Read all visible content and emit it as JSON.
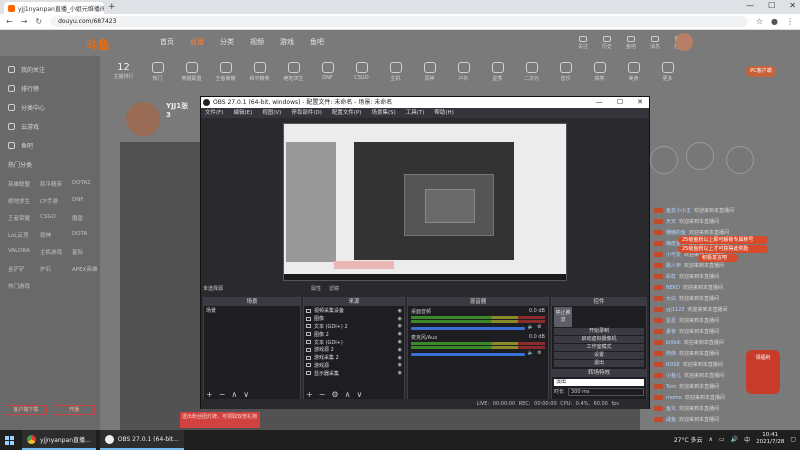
{
  "browser": {
    "tab_title": "yjj1nyanpan直播_小姐元维播间",
    "url": "douyu.com/687423",
    "window_controls": [
      "—",
      "☐",
      "✕"
    ]
  },
  "douyu": {
    "logo": "斗鱼",
    "nav": [
      "首页",
      "直播",
      "分类",
      "视频",
      "游戏",
      "鱼吧"
    ],
    "active_nav": "直播",
    "sidebar": [
      "我的关注",
      "排行榜",
      "分类中心",
      "云游戏",
      "鱼吧"
    ],
    "sidebar_section_title": "热门分类",
    "sidebar_grid": [
      "英雄联盟",
      "和平精英",
      "DOTA2",
      "绝地求生",
      "CF手游",
      "DNF",
      "王者荣耀",
      "CSGO",
      "魔兽",
      "LoL云顶",
      "原神",
      "DOTA",
      "VALORA",
      "主机游戏",
      "星际",
      "金铲铲",
      "炉石",
      "APEX英雄",
      "热门游戏",
      "",
      "",
      "",
      "",
      "",
      "",
      "",
      ""
    ],
    "sidebar_buttons": [
      "客户端下载",
      "开播"
    ],
    "category_count": "12",
    "categories": [
      "主播排行",
      "热门",
      "英雄联盟",
      "王者荣耀",
      "和平精英",
      "绝地求生",
      "DNF",
      "CSGO",
      "主机",
      "原神",
      "户外",
      "星秀",
      "二次元",
      "音乐",
      "搞笑",
      "美食",
      "更多",
      "更多"
    ],
    "pc_button": "PC客户端",
    "header_icons": [
      "关注",
      "历史",
      "鱼吧",
      "消息",
      "任务"
    ],
    "streamer_name": "YJJ1张3",
    "chat_lines": [
      {
        "name": "鱼友小小主",
        "text": "欢迎来到本直播间"
      },
      {
        "name": "天天",
        "text": "欢迎来到本直播间"
      },
      {
        "name": "懒懒的鱼",
        "text": "欢迎来到本直播间"
      },
      {
        "name": "嗨皮鱼丸",
        "text": "欢迎来到本直播间"
      },
      {
        "name": "小可爱",
        "text": "欢迎来到本直播间"
      },
      {
        "name": "路人甲",
        "text": "欢迎来到本直播间"
      },
      {
        "name": "彩虹",
        "text": "欢迎来到本直播间"
      },
      {
        "name": "NEKO",
        "text": "欢迎来到本直播间"
      },
      {
        "name": "大白",
        "text": "欢迎来到本直播间"
      },
      {
        "name": "yjj1123",
        "text": "欢迎来到本直播间"
      },
      {
        "name": "星星",
        "text": "欢迎来到本直播间"
      },
      {
        "name": "夏夜",
        "text": "欢迎来到本直播间"
      },
      {
        "name": "bilibili",
        "text": "欢迎来到本直播间"
      },
      {
        "name": "阿伟",
        "text": "欢迎来到本直播间"
      },
      {
        "name": "ROSE",
        "text": "欢迎来到本直播间"
      },
      {
        "name": "小鱼儿",
        "text": "欢迎来到本直播间"
      },
      {
        "name": "Tom",
        "text": "欢迎来到本直播间"
      },
      {
        "name": "momo",
        "text": "欢迎来到本直播间"
      },
      {
        "name": "鱼丸",
        "text": "欢迎来到本直播间"
      },
      {
        "name": "咸鱼",
        "text": "欢迎来到本直播间"
      }
    ],
    "banner_lines": [
      "25级鱼粉以上即可解锁专属称号",
      "25级鱼粉以上才可获得此奖励",
      "积极发言吧"
    ],
    "promo_text": "领福利",
    "gift_text": "送出粉丝团灯牌，可领取双倍礼物"
  },
  "obs": {
    "title": "OBS 27.0.1 (64-bit, windows) - 配置文件: 未命名 - 场景: 未命名",
    "menu": [
      "文件(F)",
      "编辑(E)",
      "视图(V)",
      "停靠部件(D)",
      "配置文件(P)",
      "场景集(S)",
      "工具(T)",
      "帮助(H)"
    ],
    "preview_label": "未选择源",
    "toggle_studio": "属性",
    "toggle_filters": "滤镜",
    "docks": {
      "scenes_title": "场景",
      "sources_title": "来源",
      "mixer_title": "混音器",
      "transitions_title": "转场特效",
      "controls_title": "控件"
    },
    "scenes": [
      "场景"
    ],
    "sources": [
      "视频采集设备",
      "图像",
      "文本 (GDI+) 2",
      "图像 2",
      "文本 (GDI+)",
      "游戏源 2",
      "游戏采集 2",
      "游戏源",
      "显示器采集"
    ],
    "mixer": [
      {
        "name": "桌面音频",
        "db": "0.0 dB"
      },
      {
        "name": "麦克风/Aux",
        "db": "0.0 dB"
      }
    ],
    "controls": [
      "停止推流",
      "开始录制",
      "启动虚拟摄像机",
      "工作室模式",
      "设置",
      "退出"
    ],
    "transition_selected": "淡出",
    "duration_label": "时长",
    "duration_value": "300 ms",
    "status": "LIVE: 00:00:00   REC: 00:00:00   CPU: 0.4%, 60.00 fps"
  },
  "taskbar": {
    "apps": [
      "yjjnyanpan直播...",
      "OBS 27.0.1 (64-bit..."
    ],
    "weather": "27°C 多云",
    "lang": "中",
    "time": "10:41",
    "date": "2021/7/28"
  }
}
